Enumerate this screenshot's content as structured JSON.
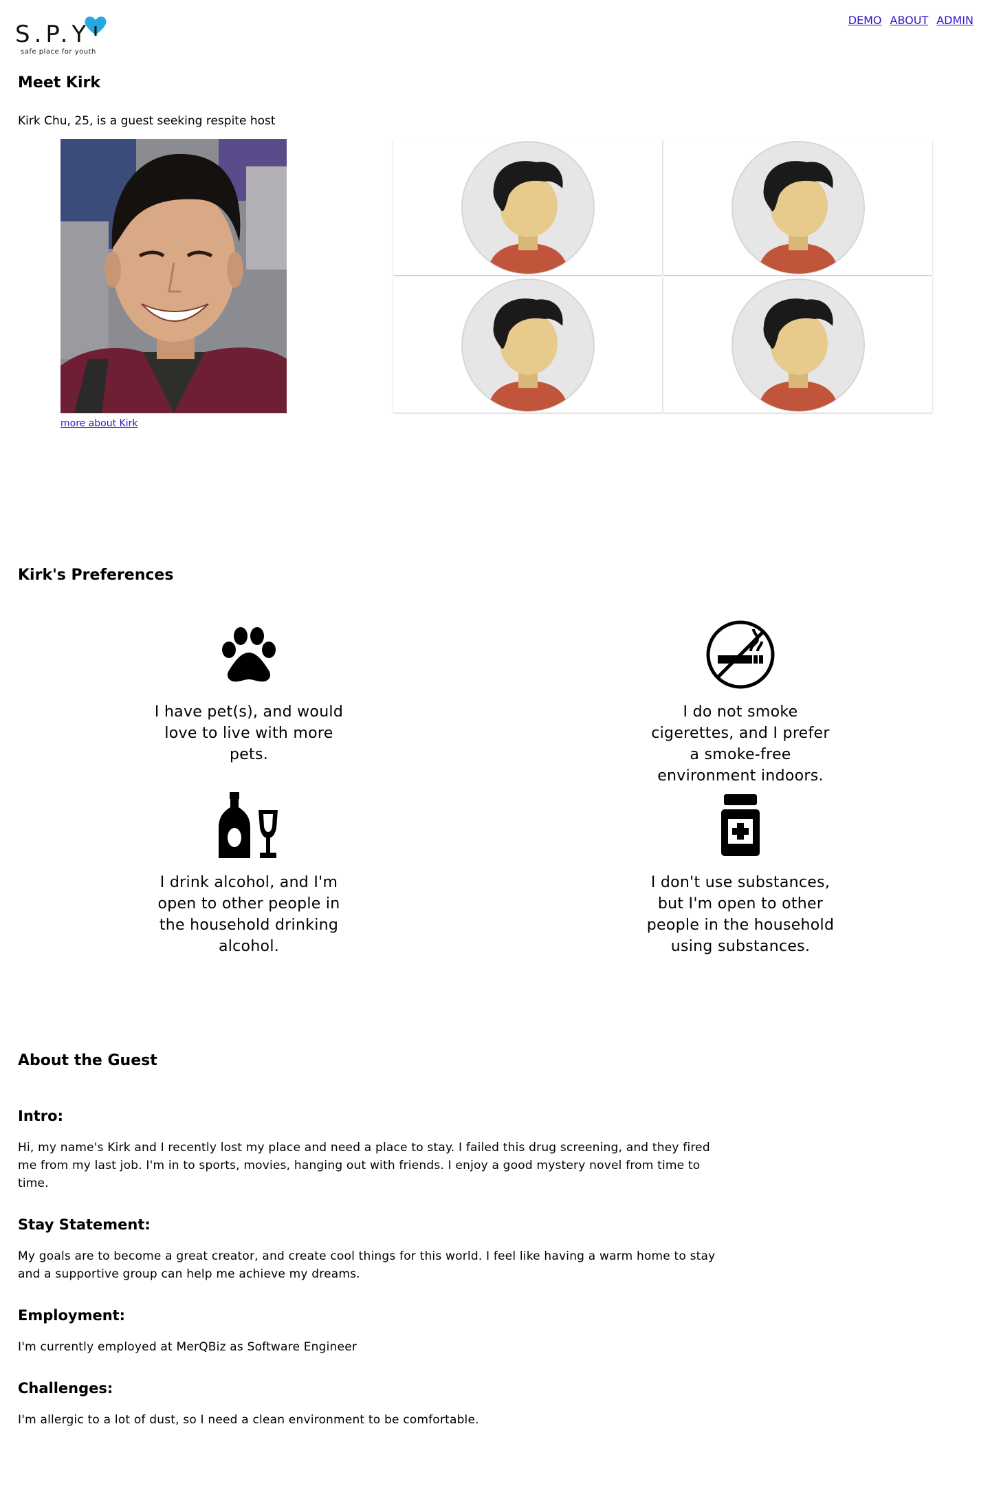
{
  "header": {
    "logo_letters": "S.P.Y",
    "logo_tagline": "safe place for youth",
    "nav": [
      "DEMO",
      "ABOUT",
      "ADMIN"
    ]
  },
  "intro": {
    "title": "Meet Kirk",
    "subtitle": "Kirk Chu, 25, is a guest seeking respite host",
    "more_link": "more about Kirk"
  },
  "preferences": {
    "title": "Kirk's Preferences",
    "items": [
      {
        "icon": "paw-icon",
        "text": "I have pet(s), and would love to live with more pets."
      },
      {
        "icon": "no-smoking-icon",
        "text": "I do not smoke cigerettes, and I prefer a smoke-free environment indoors."
      },
      {
        "icon": "alcohol-icon",
        "text": "I drink alcohol, and I'm open to other people in the household drinking alcohol."
      },
      {
        "icon": "medicine-bottle-icon",
        "text": "I don't use substances, but I'm open to other people in the household using substances."
      }
    ]
  },
  "about": {
    "title": "About the Guest",
    "sections": [
      {
        "heading": "Intro:",
        "body": "Hi, my name's Kirk and I recently lost my place and need a place to stay. I failed this drug screening, and they fired me from my last job. I'm in to sports, movies, hanging out with friends. I enjoy a good mystery novel from time to time."
      },
      {
        "heading": "Stay Statement:",
        "body": "My goals are to become a great creator, and create cool things for this world. I feel like having a warm home to stay and a supportive group can help me achieve my dreams."
      },
      {
        "heading": "Employment:",
        "body": "I'm currently employed at MerQBiz as Software Engineer"
      },
      {
        "heading": "Challenges:",
        "body": "I'm allergic to a lot of dust, so I need a clean environment to be comfortable."
      }
    ]
  },
  "colors": {
    "link": "#2a16c8",
    "logo_heart": "#29a8e0",
    "avatar_bg": "#e6e6e6",
    "avatar_hair": "#1a1a1a",
    "avatar_skin": "#e8ca8c",
    "avatar_shirt": "#c0553b"
  }
}
